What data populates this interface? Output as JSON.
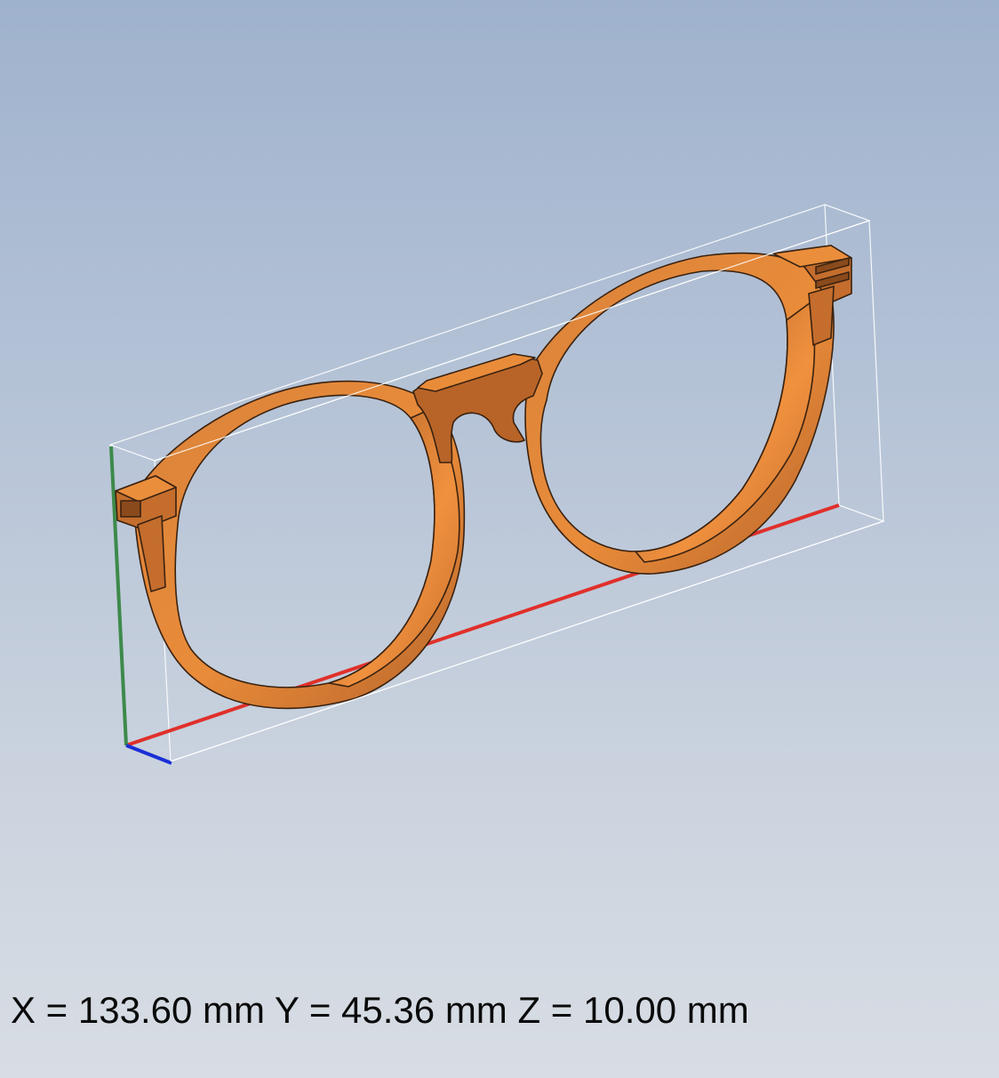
{
  "viewport": {
    "background_top": "#9fb2cd",
    "background_bottom": "#d8dde4"
  },
  "model": {
    "object": "eyeglasses-frame",
    "color": "#e0873a",
    "shade_color": "#b4632a",
    "edge_color": "#3a2210"
  },
  "axes": {
    "x_color": "#e0302a",
    "y_color": "#3c8a4a",
    "z_color": "#1a2fd6"
  },
  "bounding_box": {
    "color": "#ffffff"
  },
  "readout": {
    "x_label": "X = ",
    "x_value": "133.60",
    "x_unit": " mm",
    "y_label": " Y = ",
    "y_value": "45.36",
    "y_unit": " mm",
    "z_label": " Z = ",
    "z_value": "10.00",
    "z_unit": " mm"
  }
}
